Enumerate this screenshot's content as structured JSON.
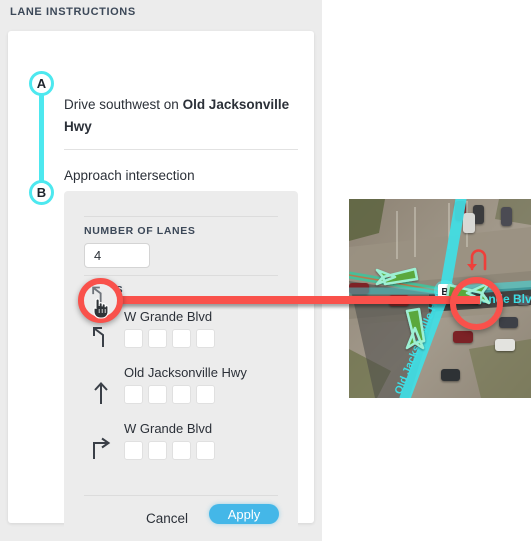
{
  "sidebar": {
    "title": "LANE INSTRUCTIONS",
    "steps": [
      {
        "badge": "A",
        "text_prefix": "Drive southwest on ",
        "text_bold": "Old Jacksonville Hwy"
      },
      {
        "badge": "B",
        "text_prefix": "Approach intersection",
        "text_bold": ""
      }
    ]
  },
  "lane_panel": {
    "lanes_label": "NUMBER OF LANES",
    "lanes_value": "4",
    "lanes_placeholder": "4",
    "turns_label": "TURNS",
    "turns": [
      {
        "icon": "slight-left-arrow-icon",
        "name": "W Grande Blvd",
        "lanes": [
          false,
          false,
          false,
          false
        ]
      },
      {
        "icon": "straight-arrow-icon",
        "name": "Old Jacksonville Hwy",
        "lanes": [
          false,
          false,
          false,
          false
        ]
      },
      {
        "icon": "right-turn-arrow-icon",
        "name": "W Grande Blvd",
        "lanes": [
          false,
          false,
          false,
          false
        ]
      }
    ],
    "cancel_label": "Cancel",
    "apply_label": "Apply"
  },
  "map": {
    "waypoint_label": "B",
    "street_labels": [
      {
        "text": "W Grande Blvd",
        "orientation": "horizontal"
      },
      {
        "text": "Old Jacksonville Hwy",
        "orientation": "diagonal"
      }
    ],
    "maneuver_arrows": [
      "left-arrow-icon",
      "down-arrow-icon",
      "right-arrow-icon"
    ],
    "uturn_icon": "u-turn-icon"
  },
  "annotation": {
    "cursor_icon": "pointing-hand-cursor-icon",
    "highlight_color": "#f9514b",
    "connector": "callout-line"
  },
  "colors": {
    "accent_cyan": "#4de8ef",
    "apply_blue": "#44b7e8",
    "highlight_red": "#f9514b",
    "sidebar_gray": "#ececec",
    "text_dark": "#2b3038",
    "map_route": "#4de8ef",
    "map_arrow_green": "#5aa83c"
  }
}
